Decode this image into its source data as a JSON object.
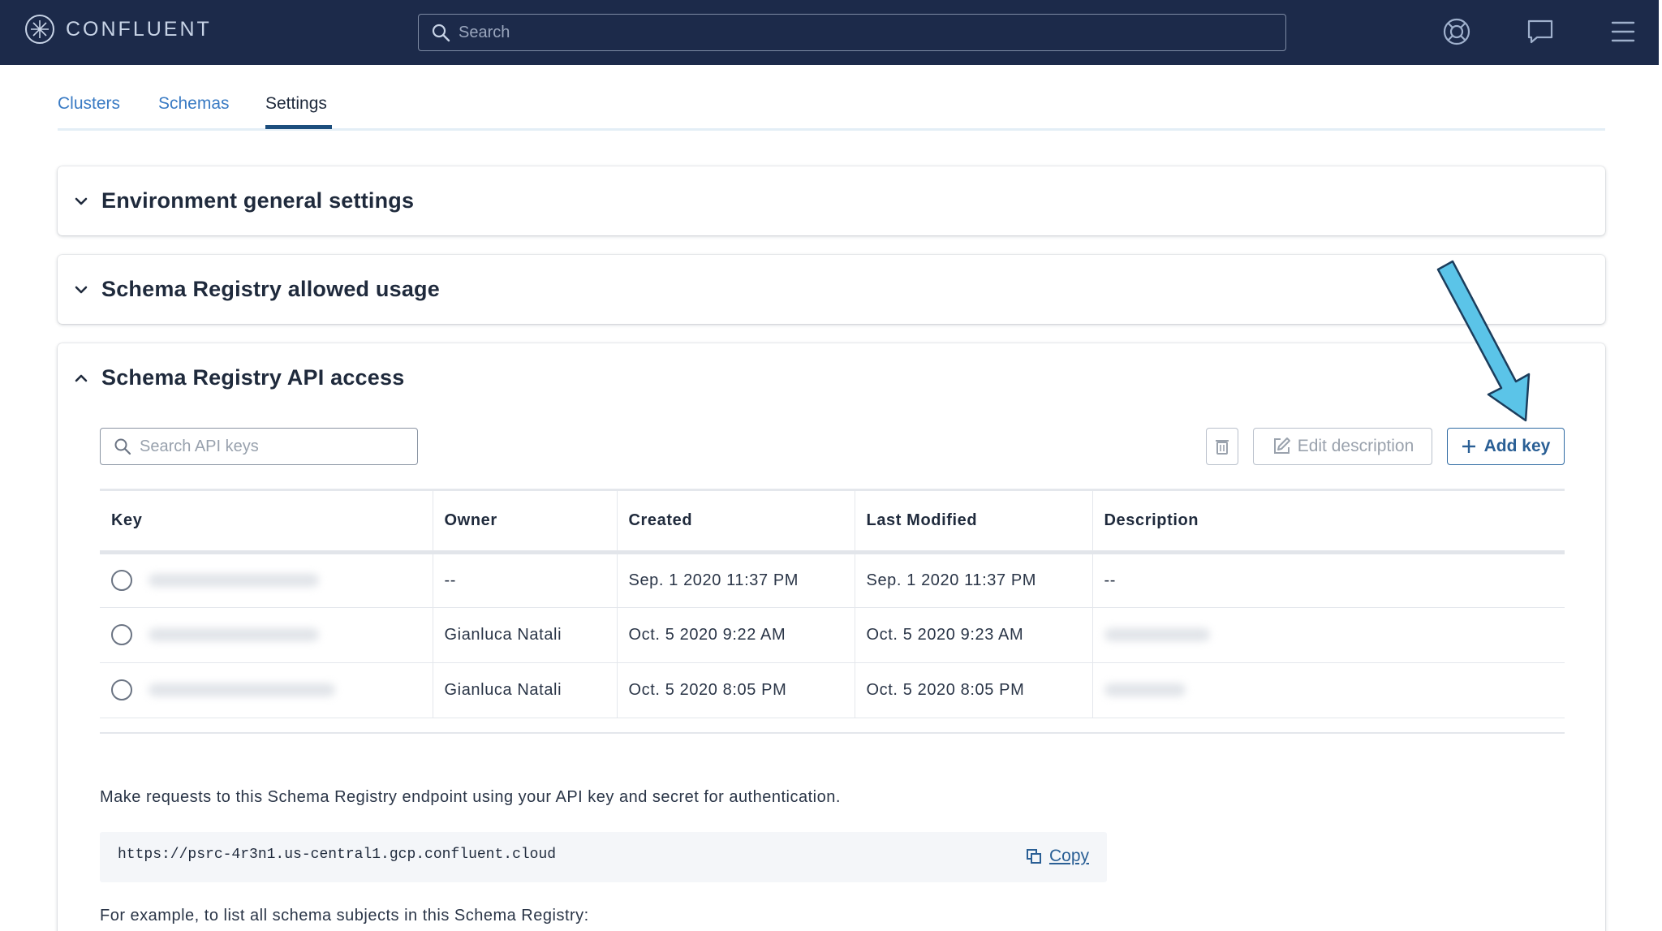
{
  "header": {
    "logo_text": "CONFLUENT",
    "search_placeholder": "Search",
    "icons": [
      "help-lifebuoy-icon",
      "chat-icon",
      "menu-icon"
    ]
  },
  "tabs": [
    {
      "label": "Clusters",
      "active": false
    },
    {
      "label": "Schemas",
      "active": false
    },
    {
      "label": "Settings",
      "active": true
    }
  ],
  "sections": {
    "general": {
      "title": "Environment general settings",
      "expanded": false
    },
    "usage": {
      "title": "Schema Registry allowed usage",
      "expanded": false
    },
    "api": {
      "title": "Schema Registry API access",
      "expanded": true
    }
  },
  "api": {
    "search_placeholder": "Search API keys",
    "edit_label": "Edit description",
    "add_label": "Add key",
    "columns": {
      "key": "Key",
      "owner": "Owner",
      "created": "Created",
      "modified": "Last Modified",
      "description": "Description"
    },
    "rows": [
      {
        "owner": "--",
        "created": "Sep. 1 2020 11:37 PM",
        "modified": "Sep. 1 2020 11:37 PM",
        "description": "--"
      },
      {
        "owner": "Gianluca Natali",
        "created": "Oct. 5 2020 9:22 AM",
        "modified": "Oct. 5 2020 9:23 AM",
        "description": ""
      },
      {
        "owner": "Gianluca Natali",
        "created": "Oct. 5 2020 8:05 PM",
        "modified": "Oct. 5 2020 8:05 PM",
        "description": ""
      }
    ],
    "endpoint_text": "Make requests to this Schema Registry endpoint using your API key and secret for authentication.",
    "endpoint_url": "https://psrc-4r3n1.us-central1.gcp.confluent.cloud",
    "copy_label": "Copy",
    "example_text": "For example, to list all schema subjects in this Schema Registry:"
  },
  "colors": {
    "topbar": "#1c2a4a",
    "link": "#3a7bc4",
    "accent": "#2a5f95",
    "annotation_arrow": "#5bc4e8"
  }
}
